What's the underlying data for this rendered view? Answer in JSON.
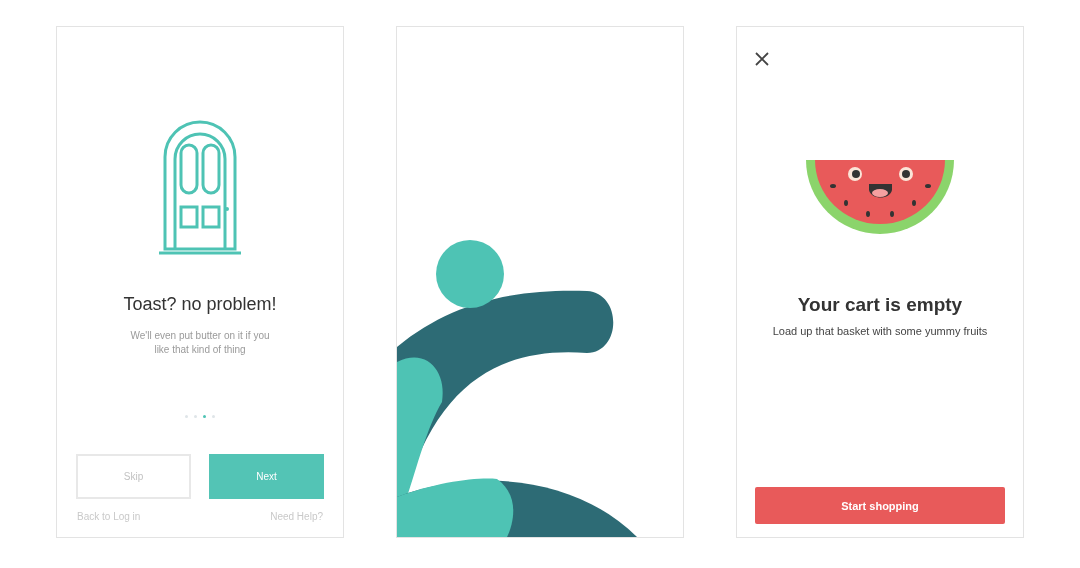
{
  "onboarding": {
    "title": "Toast? no problem!",
    "subtitle": "We'll even put butter on it if you like that kind of thing",
    "dots": [
      {
        "selected": false
      },
      {
        "selected": false
      },
      {
        "selected": true
      },
      {
        "selected": false
      }
    ],
    "buttons": [
      {
        "label": "Skip",
        "kind": "secondary"
      },
      {
        "label": "Next",
        "kind": "primary"
      }
    ],
    "links": [
      "Back to Log in",
      "Need Help?"
    ]
  },
  "cart": {
    "title": "Your cart is empty",
    "subtitle": "Load up that basket with some yummy fruits",
    "button": "Start shopping"
  }
}
